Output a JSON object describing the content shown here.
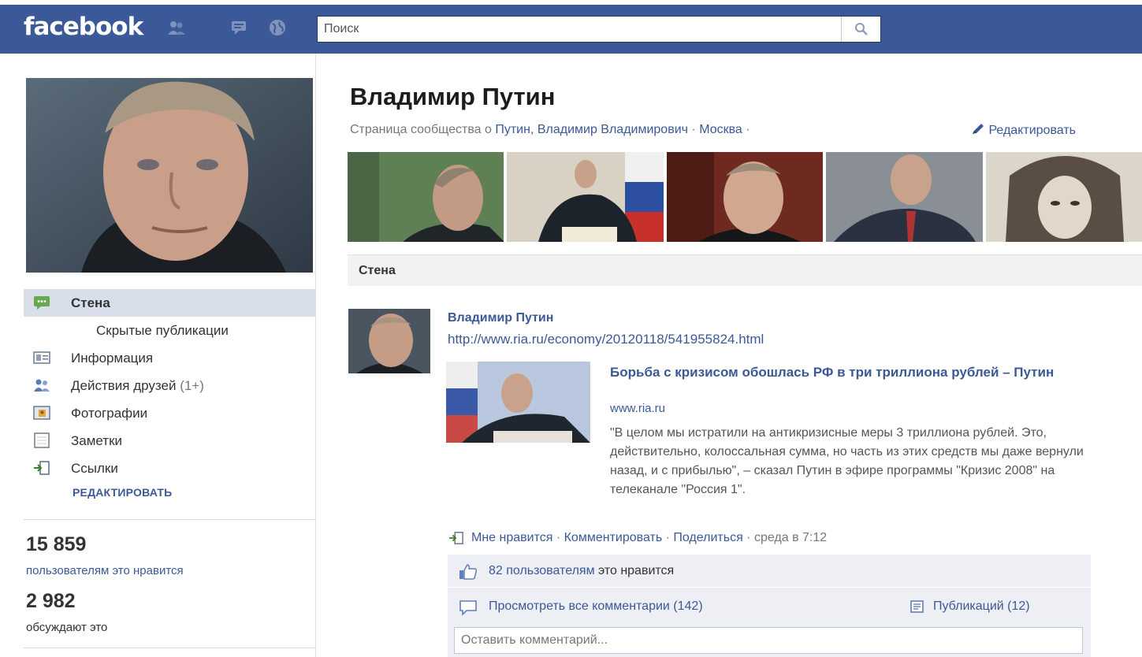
{
  "header": {
    "logo": "facebook",
    "search_placeholder": "Поиск",
    "brand_color": "#3b5998",
    "jewels": [
      "friend-requests-icon",
      "messages-icon",
      "notifications-globe-icon"
    ]
  },
  "profile": {
    "name": "Владимир Путин",
    "subline_prefix": "Страница сообщества о",
    "subline_topic": "Путин, Владимир Владимирович",
    "subline_location": "Москва",
    "edit_label": "Редактировать"
  },
  "sidebar": {
    "items": [
      {
        "label": "Стена",
        "icon": "wall-icon",
        "active": true
      },
      {
        "label": "Скрытые публикации",
        "icon": "",
        "sub": true
      },
      {
        "label": "Информация",
        "icon": "info-icon"
      },
      {
        "label": "Действия друзей",
        "count": "(1+)",
        "icon": "friends-activity-icon"
      },
      {
        "label": "Фотографии",
        "icon": "photos-icon"
      },
      {
        "label": "Заметки",
        "icon": "notes-icon"
      },
      {
        "label": "Ссылки",
        "icon": "links-icon"
      }
    ],
    "edit_label": "РЕДАКТИРОВАТЬ",
    "likes_count": "15 859",
    "likes_label": "пользователям это нравится",
    "talking_count": "2 982",
    "talking_label": "обсуждают это"
  },
  "wall": {
    "tab_label": "Стена"
  },
  "post": {
    "author": "Владимир Путин",
    "url": "http://www.ria.ru/economy/20120118/541955824.html",
    "attachment": {
      "title": "Борьба с кризисом обошлась РФ в три триллиона рублей – Путин",
      "domain": "www.ria.ru",
      "description": "\"В целом мы истратили на антикризисные меры 3 триллиона рублей. Это, действительно, колоссальная сумма, но часть из этих средств мы даже вернули назад, и с прибылью\", – сказал Путин в эфире программы \"Кризис 2008\" на телеканале \"Россия 1\"."
    },
    "actions": {
      "like": "Мне нравится",
      "comment": "Комментировать",
      "share": "Поделиться",
      "time": "среда в 7:12"
    },
    "likes_count_link": "82 пользователям",
    "likes_suffix": "это нравится",
    "view_comments": "Просмотреть все комментарии (142)",
    "shares": "Публикаций (12)",
    "comment_placeholder": "Оставить комментарий..."
  }
}
